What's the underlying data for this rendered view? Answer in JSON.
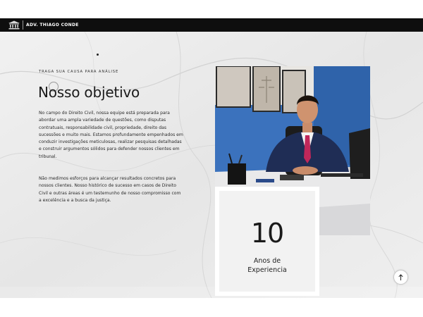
{
  "header": {
    "brand_name": "ADV. THIAGO CONDE",
    "logo_icon": "pillar-building-icon"
  },
  "main": {
    "eyebrow": "TRAGA SUA CAUSA PARA ANÁLISE",
    "title": "Nosso objetivo",
    "paragraph_1": "No campo do Direito Civil, nossa equipe está preparada para abordar uma ampla variedade de questões, como disputas contratuais, responsabilidade civil, propriedade, direito das sucessões e muito mais. Estamos profundamente empenhados em conduzir investigações meticulosas, realizar pesquisas detalhadas e construir argumentos sólidos para defender nossos clientes em tribunal.",
    "paragraph_2": "Não medimos esforços para alcançar resultados concretos para nossos clientes. Nosso histórico de sucesso em casos de Direito Civil e outras áreas é um testemunho de nosso compromisso com a excelência e a busca da justiça."
  },
  "stat": {
    "number": "10",
    "label_line1": "Anos de",
    "label_line2": "Experiencia"
  },
  "scroll_top": {
    "icon": "arrow-up-icon"
  },
  "colors": {
    "navbar": "#0e0e0e",
    "marble": "#ebebeb",
    "wall_blue": "#3a6fb8",
    "text": "#1a1a1a"
  }
}
